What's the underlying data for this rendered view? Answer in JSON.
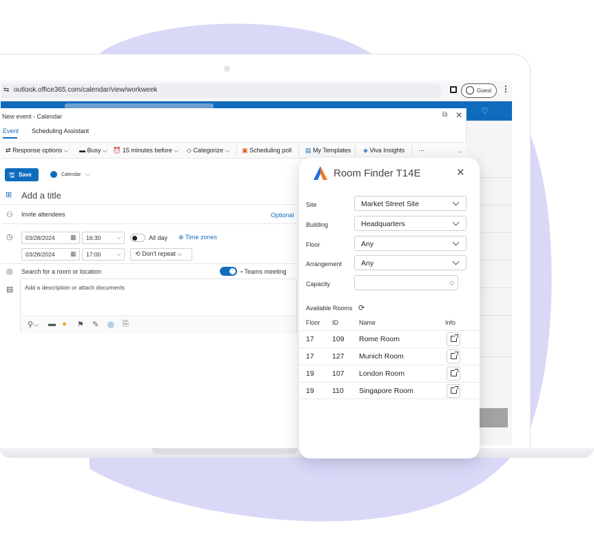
{
  "browser": {
    "url": "outlook.office365.com/calendar/view/workweek",
    "profile_label": "Guest"
  },
  "event_window": {
    "title": "New event - Calendar",
    "tabs": [
      "Event",
      "Scheduling Assistant"
    ],
    "ribbon": [
      {
        "label": "Response options",
        "icon": "response-icon"
      },
      {
        "label": "Busy",
        "icon": "busy-icon"
      },
      {
        "label": "15 minutes before",
        "icon": "alarm-icon"
      },
      {
        "label": "Categorize",
        "icon": "tag-icon"
      },
      {
        "label": "Scheduling poll",
        "icon": "poll-icon"
      },
      {
        "label": "My Templates",
        "icon": "templates-icon"
      },
      {
        "label": "Viva Insights",
        "icon": "viva-icon"
      },
      {
        "label": "···",
        "icon": "more-icon"
      }
    ],
    "save_label": "Save",
    "calendar_label": "Calendar",
    "title_placeholder": "Add a title",
    "attendees_placeholder": "Invite attendees",
    "optional_label": "Optional",
    "start_date": "03/28/2024",
    "start_time": "16:30",
    "end_date": "03/28/2024",
    "end_time": "17:00",
    "all_day_label": "All day",
    "time_zones_label": "Time zones",
    "repeat_label": "Don't repeat",
    "location_placeholder": "Search for a room or location",
    "teams_label": "Teams meeting",
    "description_placeholder": "Add a description or attach documents"
  },
  "room_finder": {
    "title": "Room Finder T14E",
    "fields": [
      {
        "label": "Site",
        "value": "Market Street Site"
      },
      {
        "label": "Building",
        "value": "Headquarters"
      },
      {
        "label": "Floor",
        "value": "Any"
      },
      {
        "label": "Arrangement",
        "value": "Any"
      }
    ],
    "capacity_label": "Capacity",
    "capacity_value": "",
    "available_label": "Available Rooms",
    "columns": [
      "Floor",
      "ID",
      "Name",
      "Info"
    ],
    "rooms": [
      {
        "floor": "17",
        "id": "109",
        "name": "Rome Room"
      },
      {
        "floor": "17",
        "id": "127",
        "name": "Munich Room"
      },
      {
        "floor": "19",
        "id": "107",
        "name": "London Room"
      },
      {
        "floor": "19",
        "id": "110",
        "name": "Singapore Room"
      }
    ]
  },
  "colors": {
    "brand_blue": "#0f6cbd",
    "blob_purple": "#d9d8f7",
    "logo_blue": "#1f6fe0",
    "logo_orange": "#f07a1e"
  }
}
